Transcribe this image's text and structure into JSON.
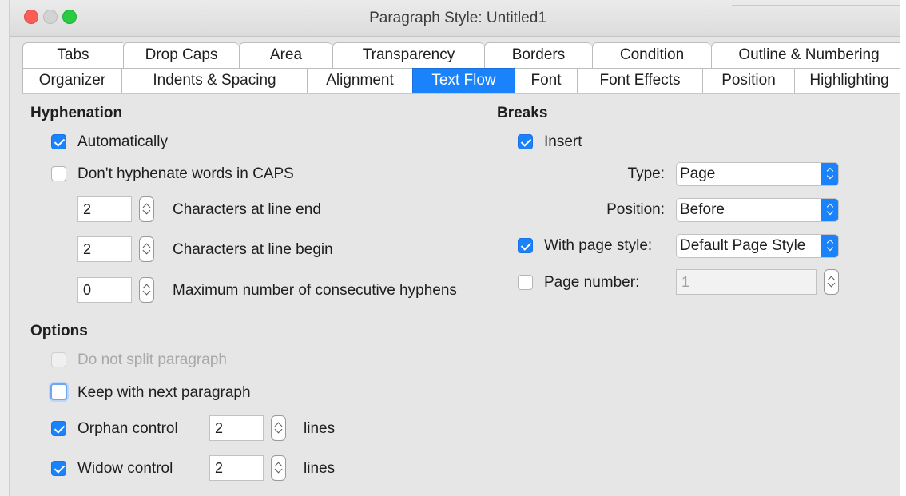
{
  "window": {
    "title": "Paragraph Style: Untitled1"
  },
  "tabs_row1": [
    "Tabs",
    "Drop Caps",
    "Area",
    "Transparency",
    "Borders",
    "Condition",
    "Outline & Numbering"
  ],
  "tabs_row2": [
    "Organizer",
    "Indents & Spacing",
    "Alignment",
    "Text Flow",
    "Font",
    "Font Effects",
    "Position",
    "Highlighting"
  ],
  "active_tab": "Text Flow",
  "hyphenation": {
    "title": "Hyphenation",
    "automatically": {
      "label": "Automatically",
      "checked": true
    },
    "caps": {
      "label": "Don't hyphenate words in CAPS",
      "checked": false
    },
    "line_end": {
      "value": "2",
      "label": "Characters at line end"
    },
    "line_begin": {
      "value": "2",
      "label": "Characters at line begin"
    },
    "max_hyphens": {
      "value": "0",
      "label": "Maximum number of consecutive hyphens"
    }
  },
  "options": {
    "title": "Options",
    "no_split": {
      "label": "Do not split paragraph",
      "checked": false,
      "disabled": true
    },
    "keep_next": {
      "label": "Keep with next paragraph",
      "checked": false
    },
    "orphan": {
      "label": "Orphan control",
      "checked": true,
      "value": "2",
      "unit": "lines"
    },
    "widow": {
      "label": "Widow control",
      "checked": true,
      "value": "2",
      "unit": "lines"
    }
  },
  "breaks": {
    "title": "Breaks",
    "insert": {
      "label": "Insert",
      "checked": true
    },
    "type": {
      "label": "Type:",
      "value": "Page"
    },
    "position": {
      "label": "Position:",
      "value": "Before"
    },
    "page_style": {
      "label": "With page style:",
      "checked": true,
      "value": "Default Page Style"
    },
    "page_number": {
      "label": "Page number:",
      "checked": false,
      "value": "1"
    }
  },
  "colors": {
    "accent": "#1a82fb",
    "panel": "#e6e6e6"
  }
}
